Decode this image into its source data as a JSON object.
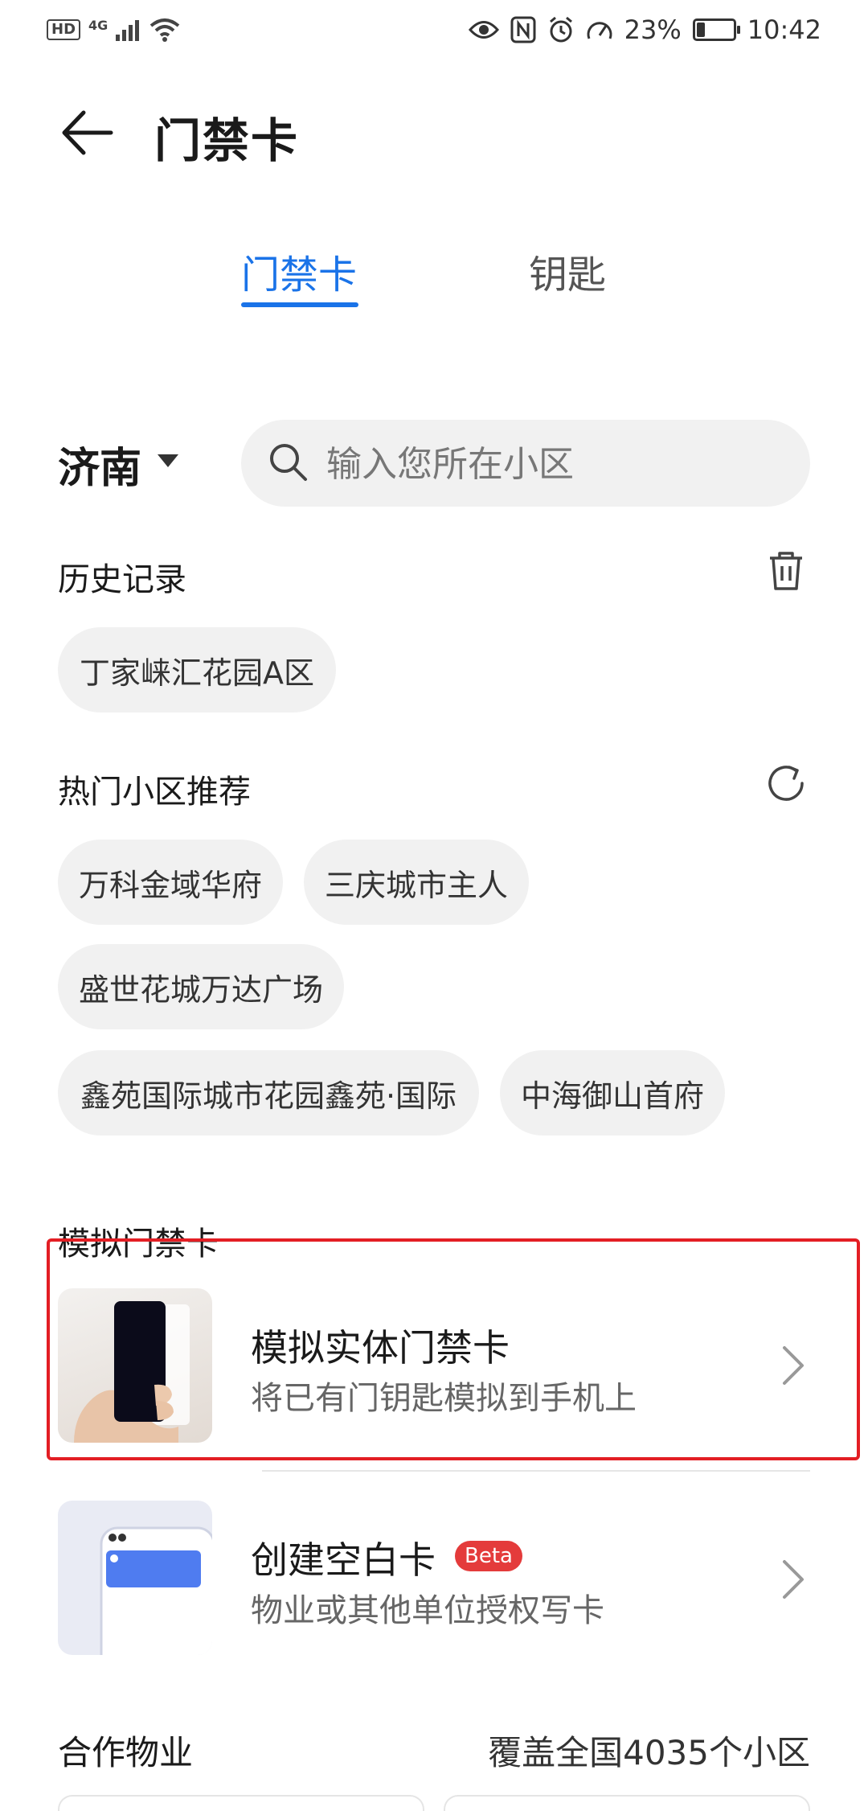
{
  "status_bar": {
    "hd": "HD",
    "network": "4G",
    "battery": "23%",
    "battery_level": 0.23,
    "time": "10:42"
  },
  "header": {
    "title": "门禁卡"
  },
  "tabs": [
    {
      "label": "门禁卡",
      "active": true
    },
    {
      "label": "钥匙",
      "active": false
    }
  ],
  "city": "济南",
  "search": {
    "placeholder": "输入您所在小区",
    "value": ""
  },
  "history": {
    "title": "历史记录",
    "items": [
      "丁家崃汇花园A区"
    ]
  },
  "hot": {
    "title": "热门小区推荐",
    "items": [
      "万科金域华府",
      "三庆城市主人",
      "盛世花城万达广场",
      "鑫苑国际城市花园鑫苑·国际",
      "中海御山首府"
    ]
  },
  "simulate": {
    "title": "模拟门禁卡",
    "items": [
      {
        "title": "模拟实体门禁卡",
        "subtitle": "将已有门钥匙模拟到手机上"
      },
      {
        "title": "创建空白卡",
        "badge": "Beta",
        "subtitle": "物业或其他单位授权写卡"
      }
    ]
  },
  "partner": {
    "title": "合作物业",
    "coverage": "覆盖全国4035个小区"
  },
  "colors": {
    "accent": "#1a73e8",
    "highlight_box": "#e31e24",
    "badge": "#e43b3b"
  }
}
